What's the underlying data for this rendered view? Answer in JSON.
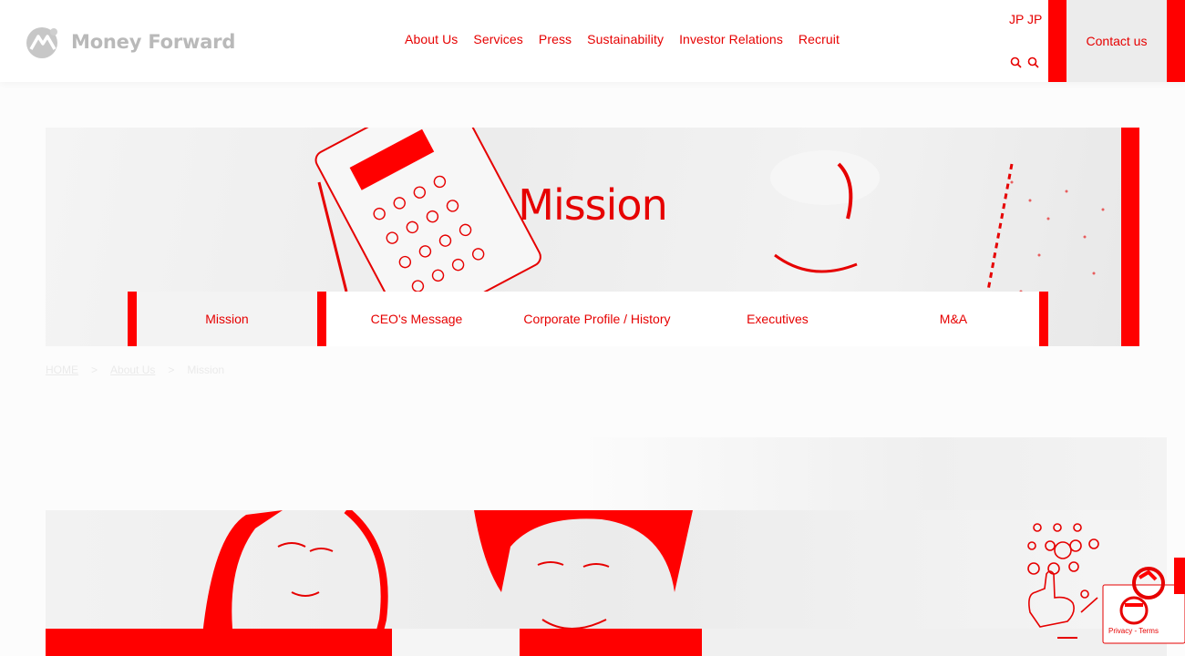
{
  "header": {
    "logo_text": "Money Forward",
    "nav": [
      "About Us",
      "Services",
      "Press",
      "Sustainability",
      "Investor Relations",
      "Recruit"
    ],
    "lang_label": "JP JP",
    "contact_label": "Contact us"
  },
  "hero": {
    "title": "Mission"
  },
  "subnav": {
    "tabs": [
      "Mission",
      "CEO's Message",
      "Corporate Profile / History",
      "Executives",
      "M&A"
    ]
  },
  "breadcrumb": {
    "home": "HOME",
    "about": "About Us",
    "current": "Mission",
    "separator": ">"
  },
  "widgets": {
    "recaptcha_text": "Privacy - Terms"
  },
  "colors": {
    "accent": "#e60000",
    "header_bg": "#ffffff",
    "contact_bg": "#ececec"
  }
}
